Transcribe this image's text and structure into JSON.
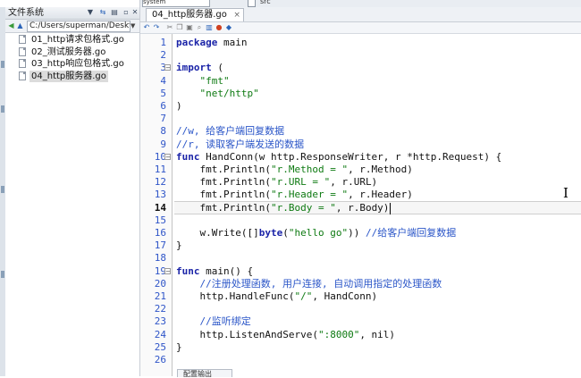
{
  "left_panel": {
    "title": "文件系统",
    "path": "C:/Users/superman/Deskt",
    "files": [
      {
        "name": "01_http请求包格式.go"
      },
      {
        "name": "02_测试服务器.go"
      },
      {
        "name": "03_http响应包格式.go"
      },
      {
        "name": "04_http服务器.go",
        "selected": true
      }
    ]
  },
  "top_bar": {
    "combo_value": "system",
    "checkbox_label": "src"
  },
  "editor": {
    "tab_label": "04_http服务器.go",
    "tab_close": "×",
    "current_line": 14,
    "bottom_panel_label": "配置输出",
    "lines": [
      [
        {
          "t": "package",
          "c": "kw"
        },
        {
          "t": " main"
        }
      ],
      [],
      [
        {
          "t": "import",
          "c": "kw"
        },
        {
          "t": " ("
        }
      ],
      [
        {
          "t": "    "
        },
        {
          "t": "\"fmt\"",
          "c": "str"
        }
      ],
      [
        {
          "t": "    "
        },
        {
          "t": "\"net/http\"",
          "c": "str"
        }
      ],
      [
        {
          "t": ")"
        }
      ],
      [],
      [
        {
          "t": "//w, 给客户端回复数据",
          "c": "cmt"
        }
      ],
      [
        {
          "t": "//r, 读取客户端发送的数据",
          "c": "cmt"
        }
      ],
      [
        {
          "t": "func",
          "c": "kw"
        },
        {
          "t": " HandConn(w http.ResponseWriter, r *http.Request) {"
        }
      ],
      [
        {
          "t": "    fmt.Println("
        },
        {
          "t": "\"r.Method = \"",
          "c": "str"
        },
        {
          "t": ", r.Method)"
        }
      ],
      [
        {
          "t": "    fmt.Println("
        },
        {
          "t": "\"r.URL = \"",
          "c": "str"
        },
        {
          "t": ", r.URL)"
        }
      ],
      [
        {
          "t": "    fmt.Println("
        },
        {
          "t": "\"r.Header = \"",
          "c": "str"
        },
        {
          "t": ", r.Header)"
        }
      ],
      [
        {
          "t": "    fmt.Println("
        },
        {
          "t": "\"r.Body = \"",
          "c": "str"
        },
        {
          "t": ", r.Body)"
        }
      ],
      [],
      [
        {
          "t": "    w.Write([]"
        },
        {
          "t": "byte",
          "c": "kw"
        },
        {
          "t": "("
        },
        {
          "t": "\"hello go\"",
          "c": "str"
        },
        {
          "t": ")) "
        },
        {
          "t": "//给客户端回复数据",
          "c": "cmt"
        }
      ],
      [
        {
          "t": "}"
        }
      ],
      [],
      [
        {
          "t": "func",
          "c": "kw"
        },
        {
          "t": " main() {"
        }
      ],
      [
        {
          "t": "    "
        },
        {
          "t": "//注册处理函数, 用户连接, 自动调用指定的处理函数",
          "c": "cmt"
        }
      ],
      [
        {
          "t": "    http.HandleFunc("
        },
        {
          "t": "\"/\"",
          "c": "str"
        },
        {
          "t": ", HandConn)"
        }
      ],
      [],
      [
        {
          "t": "    "
        },
        {
          "t": "//监听绑定",
          "c": "cmt"
        }
      ],
      [
        {
          "t": "    http.ListenAndServe("
        },
        {
          "t": "\":8000\"",
          "c": "str"
        },
        {
          "t": ", nil)"
        }
      ],
      [
        {
          "t": "}"
        }
      ],
      []
    ],
    "fold_markers": [
      3,
      10,
      19
    ]
  }
}
